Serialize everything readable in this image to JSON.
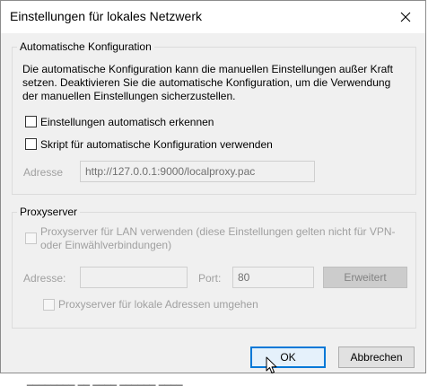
{
  "dialog": {
    "title": "Einstellungen für lokales Netzwerk",
    "auto_config": {
      "legend": "Automatische Konfiguration",
      "description": "Die automatische Konfiguration kann die manuellen Einstellungen außer Kraft setzen. Deaktivieren Sie die automatische Konfiguration, um die Verwendung der manuellen Einstellungen sicherzustellen.",
      "auto_detect_label": "Einstellungen automatisch erkennen",
      "auto_detect_checked": false,
      "script_label": "Skript für automatische Konfiguration verwenden",
      "script_checked": false,
      "address_label": "Adresse",
      "address_value": "http://127.0.0.1:9000/localproxy.pac"
    },
    "proxy": {
      "legend": "Proxyserver",
      "lan_proxy_label": "Proxyserver für LAN verwenden (diese Einstellungen gelten nicht für VPN- oder Einwählverbindungen)",
      "lan_proxy_checked": false,
      "address_label": "Adresse:",
      "address_value": "",
      "port_label": "Port:",
      "port_value": "80",
      "advanced_button": "Erweitert",
      "bypass_local_label": "Proxyserver für lokale Adressen umgehen",
      "bypass_local_checked": false
    },
    "buttons": {
      "ok": "OK",
      "cancel": "Abbrechen"
    }
  },
  "background": {
    "partial_text": "________ __ ____ ______ ____"
  }
}
